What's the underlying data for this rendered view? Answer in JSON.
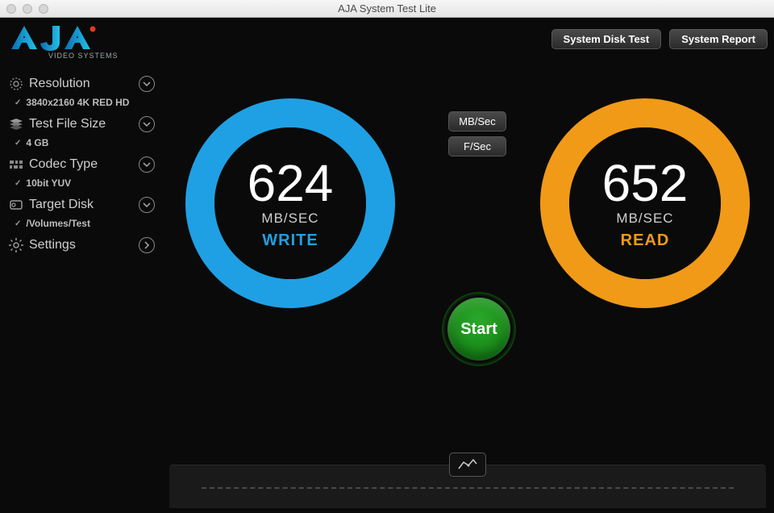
{
  "window": {
    "title": "AJA System Test Lite"
  },
  "brand": {
    "name": "AJA",
    "subtitle": "VIDEO SYSTEMS"
  },
  "top_buttons": {
    "system_disk_test": "System Disk Test",
    "system_report": "System Report"
  },
  "sidebar": {
    "resolution": {
      "label": "Resolution",
      "value": "3840x2160 4K RED HD"
    },
    "file_size": {
      "label": "Test File Size",
      "value": "4 GB"
    },
    "codec": {
      "label": "Codec Type",
      "value": "10bit YUV"
    },
    "target": {
      "label": "Target Disk",
      "value": "/Volumes/Test"
    },
    "settings": {
      "label": "Settings"
    }
  },
  "units": {
    "mbsec": "MB/Sec",
    "fsec": "F/Sec"
  },
  "gauges": {
    "write": {
      "value": "624",
      "unit": "MB/SEC",
      "label": "WRITE"
    },
    "read": {
      "value": "652",
      "unit": "MB/SEC",
      "label": "READ"
    }
  },
  "start": {
    "label": "Start"
  }
}
